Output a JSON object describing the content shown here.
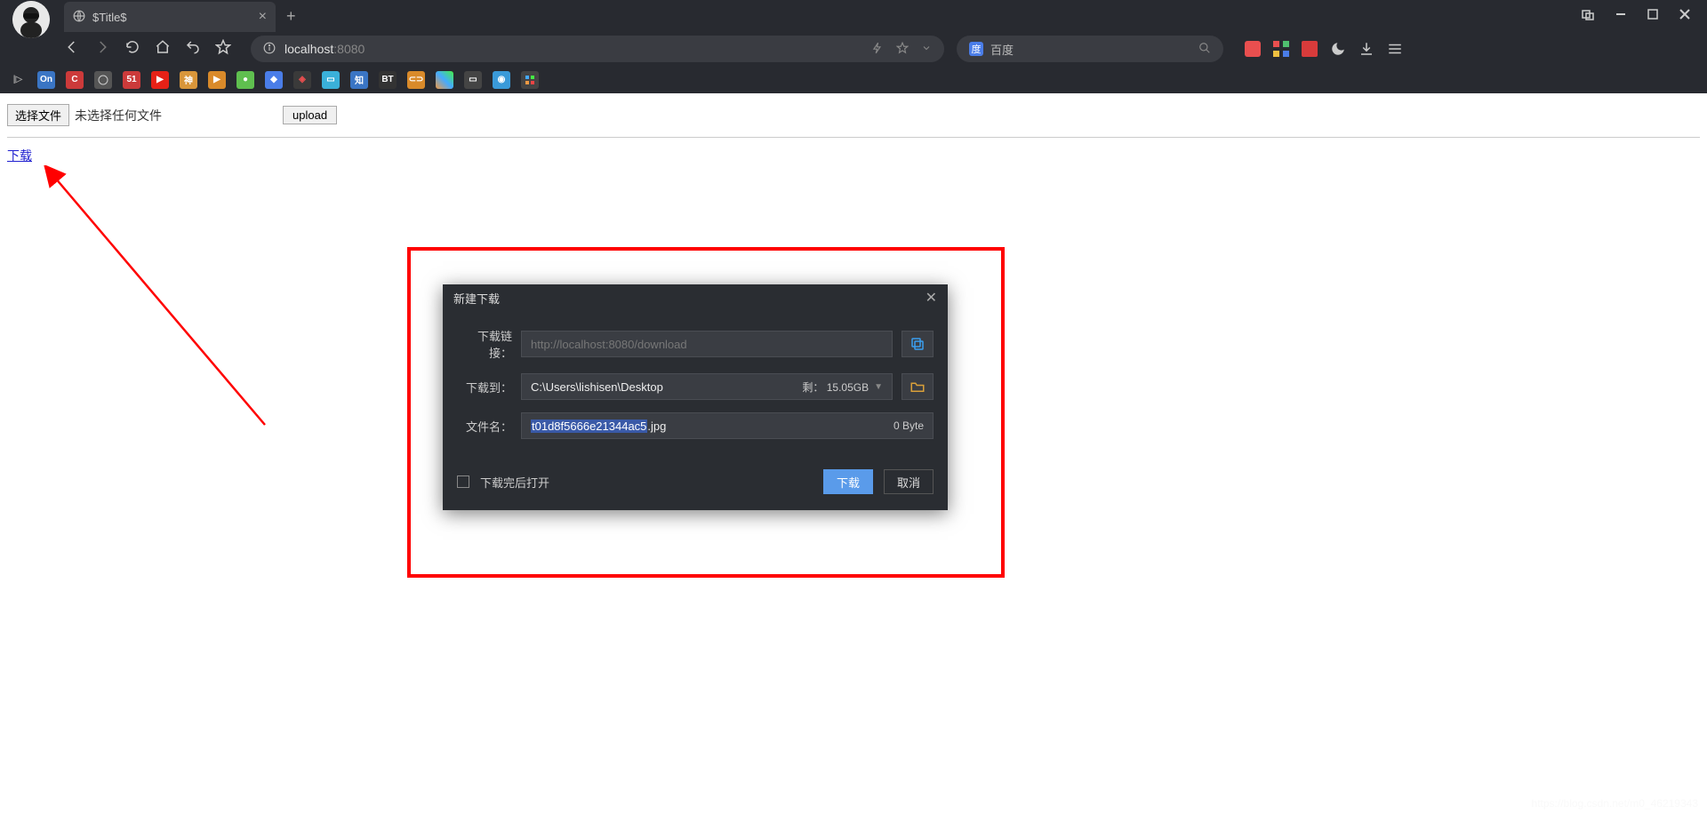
{
  "browser": {
    "tab_title": "$Title$",
    "url_host": "localhost",
    "url_port": ":8080",
    "search_placeholder": "百度",
    "search_engine_icon_text": "度"
  },
  "page": {
    "choose_file_label": "选择文件",
    "no_file_text": "未选择任何文件",
    "upload_label": "upload",
    "download_link_text": "下载"
  },
  "dialog": {
    "title": "新建下载",
    "url_label": "下载链接：",
    "url_placeholder": "http://localhost:8080/download",
    "path_label": "下载到：",
    "path_value": "C:\\Users\\lishisen\\Desktop",
    "remain_label": "剩：",
    "remain_value": "15.05GB",
    "filename_label": "文件名：",
    "filename_value": "t01d8f5666e21344ac5.jpg",
    "filename_selected_part": "t01d8f5666e21344ac5",
    "filename_ext_part": ".jpg",
    "filesize": "0 Byte",
    "open_after_label": "下载完后打开",
    "download_btn": "下载",
    "cancel_btn": "取消"
  },
  "watermark": "https://blog.csdn.net/m0_46219343"
}
